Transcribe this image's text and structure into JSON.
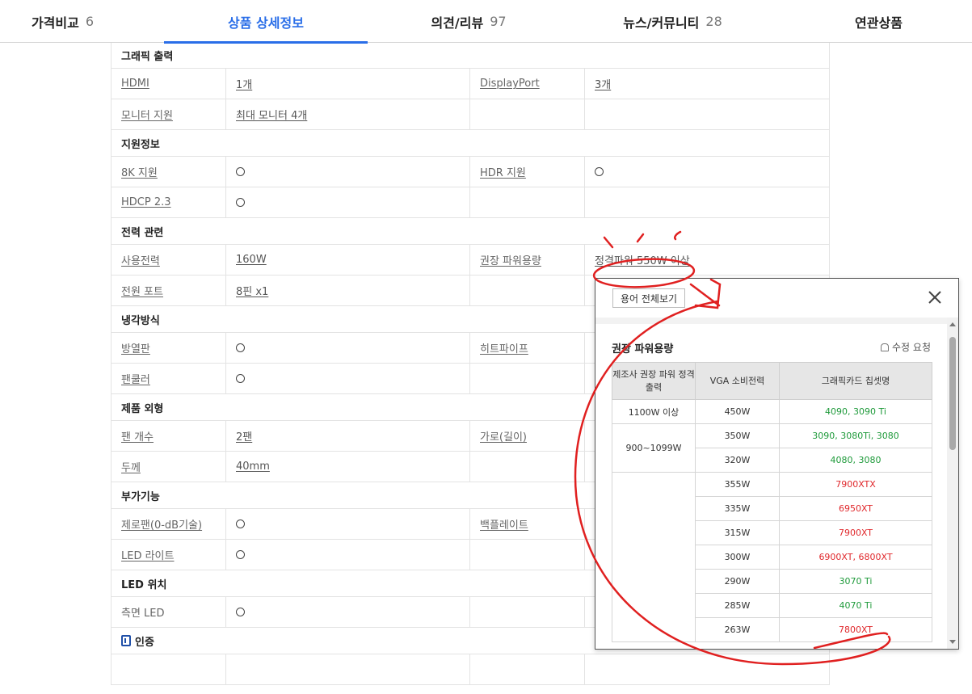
{
  "tabs": [
    {
      "label": "가격비교",
      "count": "6"
    },
    {
      "label": "상품 상세정보",
      "count": ""
    },
    {
      "label": "의견/리뷰",
      "count": "97"
    },
    {
      "label": "뉴스/커뮤니티",
      "count": "28"
    },
    {
      "label": "연관상품",
      "count": ""
    }
  ],
  "spec": {
    "graphic": {
      "title": "그래픽 출력",
      "hdmi": {
        "label": "HDMI",
        "value": "1개"
      },
      "dp": {
        "label": "DisplayPort",
        "value": "3개"
      },
      "monitor": {
        "label": "모니터 지원",
        "value": "최대 모니터 4개"
      }
    },
    "support": {
      "title": "지원정보",
      "k8": {
        "label": "8K 지원"
      },
      "hdr": {
        "label": "HDR 지원"
      },
      "hdcp": {
        "label": "HDCP 2.3"
      }
    },
    "power": {
      "title": "전력 관련",
      "usage": {
        "label": "사용전력",
        "value": "160W"
      },
      "recommended": {
        "label": "권장 파워용량",
        "value": "정격파워 550W 이상"
      },
      "port": {
        "label": "전원 포트",
        "value": "8핀 x1"
      }
    },
    "cooling": {
      "title": "냉각방식",
      "heatsink": {
        "label": "방열판"
      },
      "heatpipe": {
        "label": "히트파이프"
      },
      "fan": {
        "label": "팬쿨러"
      }
    },
    "shape": {
      "title": "제품 외형",
      "fans": {
        "label": "팬 개수",
        "value": "2팬"
      },
      "width": {
        "label": "가로(길이)"
      },
      "thickness": {
        "label": "두께",
        "value": "40mm"
      }
    },
    "extra": {
      "title": "부가기능",
      "zerofan": {
        "label": "제로팬(0-dB기술)"
      },
      "backplate": {
        "label": "백플레이트"
      },
      "led": {
        "label": "LED 라이트"
      }
    },
    "ledpos": {
      "title": "LED 위치",
      "side": {
        "label": "측면 LED"
      }
    },
    "cert": {
      "title": "인증"
    }
  },
  "popup": {
    "term_button": "용어 전체보기",
    "title": "권장 파워용량",
    "edit_request": "수정 요청",
    "headers": [
      "제조사 권장 파워 정격출력",
      "VGA 소비전력",
      "그래픽카드 칩셋명"
    ],
    "group_labels": [
      "1100W 이상",
      "900~1099W"
    ],
    "rows": [
      {
        "vga": "450W",
        "chip": "4090, 3090 Ti",
        "color": "green"
      },
      {
        "vga": "350W",
        "chip": "3090, 3080Ti, 3080",
        "color": "green"
      },
      {
        "vga": "320W",
        "chip": "4080, 3080",
        "color": "green"
      },
      {
        "vga": "355W",
        "chip": "7900XTX",
        "color": "red"
      },
      {
        "vga": "335W",
        "chip": "6950XT",
        "color": "red"
      },
      {
        "vga": "315W",
        "chip": "7900XT",
        "color": "red"
      },
      {
        "vga": "300W",
        "chip": "6900XT, 6800XT",
        "color": "red"
      },
      {
        "vga": "290W",
        "chip": "3070 Ti",
        "color": "green"
      },
      {
        "vga": "285W",
        "chip": "4070 Ti",
        "color": "green"
      },
      {
        "vga": "263W",
        "chip": "7800XT",
        "color": "red"
      }
    ]
  },
  "colors": {
    "accent": "#2a6ee8",
    "annotation": "#e02020",
    "green": "#1e9a3a",
    "red": "#e0282c"
  }
}
